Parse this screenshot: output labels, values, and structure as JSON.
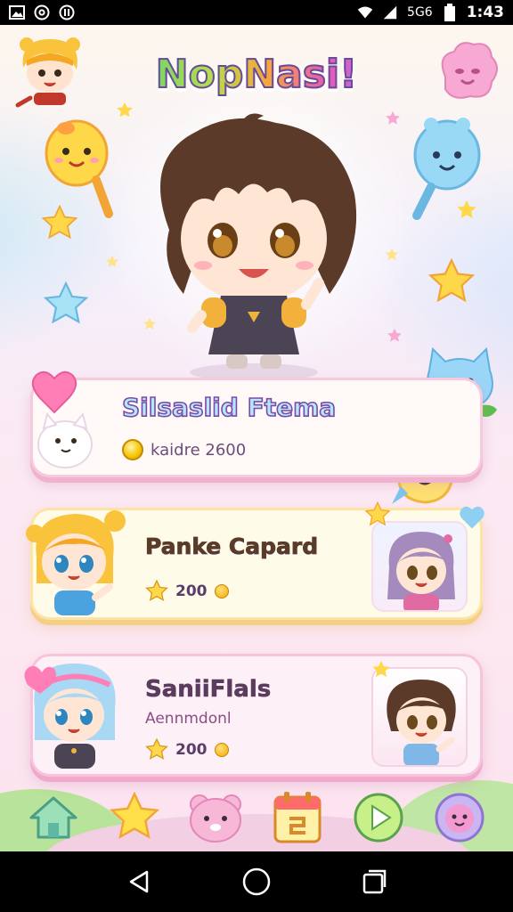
{
  "status_bar": {
    "network_label": "5G6",
    "time": "1:43"
  },
  "game": {
    "title": "NopNasi!",
    "cards": [
      {
        "title": "Silsaslid Ftema",
        "stat_text": "kaidre 2600",
        "icon": "coin-icon"
      },
      {
        "title": "Panke Capard",
        "stat_value": "200",
        "icon": "star-icon"
      },
      {
        "title": "SaniiFlals",
        "subtitle": "Aennmdonl",
        "stat_value": "200",
        "icon": "star-icon"
      }
    ],
    "dock": [
      {
        "icon": "home-icon"
      },
      {
        "icon": "star-icon"
      },
      {
        "icon": "bear-icon"
      },
      {
        "icon": "calendar-icon"
      },
      {
        "icon": "play-icon"
      },
      {
        "icon": "bubble-face-icon"
      }
    ]
  },
  "colors": {
    "card_border_pink": "#f6c9dc",
    "card_gold": "#fde3a6",
    "title_outline": "#6a4a9a",
    "status_bar": "#000000"
  }
}
